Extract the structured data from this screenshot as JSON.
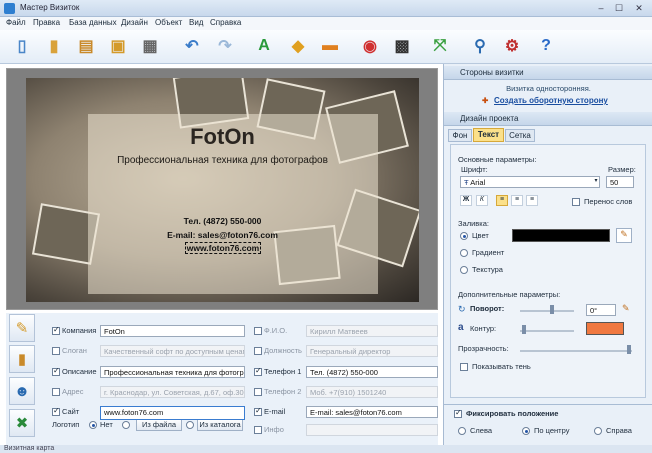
{
  "window": {
    "title": "Мастер Визиток",
    "min": "–",
    "max": "☐",
    "close": "✕"
  },
  "menu": [
    "Файл",
    "Правка",
    "База данных",
    "Дизайн",
    "Объект",
    "Вид",
    "Справка"
  ],
  "toolbar": [
    {
      "name": "new-file-icon",
      "glyph": "▯",
      "color": "#4a86c8"
    },
    {
      "name": "open-folder-icon",
      "glyph": "▮",
      "color": "#d9a23a"
    },
    {
      "name": "templates-icon",
      "glyph": "▤",
      "color": "#c98a2a"
    },
    {
      "name": "save-icon",
      "glyph": "▣",
      "color": "#d49a2a"
    },
    {
      "name": "print-icon",
      "glyph": "▦",
      "color": "#666"
    },
    {
      "name": "undo-icon",
      "glyph": "↶",
      "color": "#3a7cc9"
    },
    {
      "name": "redo-icon",
      "glyph": "↷",
      "color": "#9bb8d8"
    },
    {
      "name": "text-tool-icon",
      "glyph": "A",
      "color": "#2a9a3a"
    },
    {
      "name": "shape-tool-icon",
      "glyph": "◆",
      "color": "#e0a020"
    },
    {
      "name": "image-tool-icon",
      "glyph": "▬",
      "color": "#e08020"
    },
    {
      "name": "map-icon",
      "glyph": "◉",
      "color": "#d03030"
    },
    {
      "name": "qr-code-icon",
      "glyph": "▩",
      "color": "#333"
    },
    {
      "name": "fit-icon",
      "glyph": "⤧",
      "color": "#3aa040"
    },
    {
      "name": "zoom-icon",
      "glyph": "⚲",
      "color": "#2a6ab0"
    },
    {
      "name": "settings-icon",
      "glyph": "⚙",
      "color": "#c03030"
    },
    {
      "name": "help-icon",
      "glyph": "?",
      "color": "#2a6ac8"
    }
  ],
  "card": {
    "company": "FotOn",
    "slogan": "Профессиональная техника для фотографов",
    "phone": "Тел. (4872) 550-000",
    "email": "E-mail: sales@foton76.com",
    "site": "www.foton76.com"
  },
  "right": {
    "sides_header": "Стороны визитки",
    "sides_info": "Визитка односторонняя.",
    "create_back": "Создать оборотную сторону",
    "design_header": "Дизайн проекта",
    "tabs": [
      "Фон",
      "Текст",
      "Сетка"
    ],
    "active_tab": "Текст",
    "basic_params": "Основные параметры:",
    "font_label": "Шрифт:",
    "size_label": "Размер:",
    "font_value": "Arial",
    "size_value": "50",
    "wrap_label": "Перенос слов",
    "fill_label": "Заливка:",
    "fill_options": [
      "Цвет",
      "Градиент",
      "Текстура"
    ],
    "fill_color": "#000000",
    "extra_params": "Дополнительные параметры:",
    "rotation_label": "Поворот:",
    "rotation_value": "0°",
    "outline_label": "Контур:",
    "outline_color": "#f07840",
    "opacity_label": "Прозрачность:",
    "shadow_label": "Показывать тень",
    "fix_label": "Фиксировать положение",
    "align_options": [
      "Слева",
      "По центру",
      "Справа"
    ]
  },
  "fields": {
    "left": [
      {
        "label": "Компания",
        "checked": true,
        "value": "FotOn",
        "enabled": true
      },
      {
        "label": "Слоган",
        "checked": false,
        "value": "Качественный софт по доступным ценам",
        "enabled": false
      },
      {
        "label": "Описание",
        "checked": true,
        "value": "Профессиональная техника для фотографов",
        "enabled": true
      },
      {
        "label": "Адрес",
        "checked": false,
        "value": "г. Краснодар, ул. Советская, д.67, оф.302",
        "enabled": false
      },
      {
        "label": "Сайт",
        "checked": true,
        "value": "www.foton76.com",
        "enabled": true
      }
    ],
    "right": [
      {
        "label": "Ф.И.О.",
        "checked": false,
        "value": "Кирилл Матвеев",
        "enabled": false
      },
      {
        "label": "Должность",
        "checked": false,
        "value": "Генеральный директор",
        "enabled": false
      },
      {
        "label": "Телефон 1",
        "checked": true,
        "value": "Тел. (4872) 550-000",
        "enabled": true
      },
      {
        "label": "Телефон 2",
        "checked": false,
        "value": "Моб. +7(910) 1501240",
        "enabled": false
      },
      {
        "label": "E-mail",
        "checked": true,
        "value": "E-mail: sales@foton76.com",
        "enabled": true
      },
      {
        "label": "Инфо",
        "checked": false,
        "value": "",
        "enabled": false
      }
    ],
    "logo_label": "Логотип",
    "logo_none": "Нет",
    "from_file": "Из файла",
    "from_catalog": "Из каталога"
  },
  "status": "Визитная карта"
}
